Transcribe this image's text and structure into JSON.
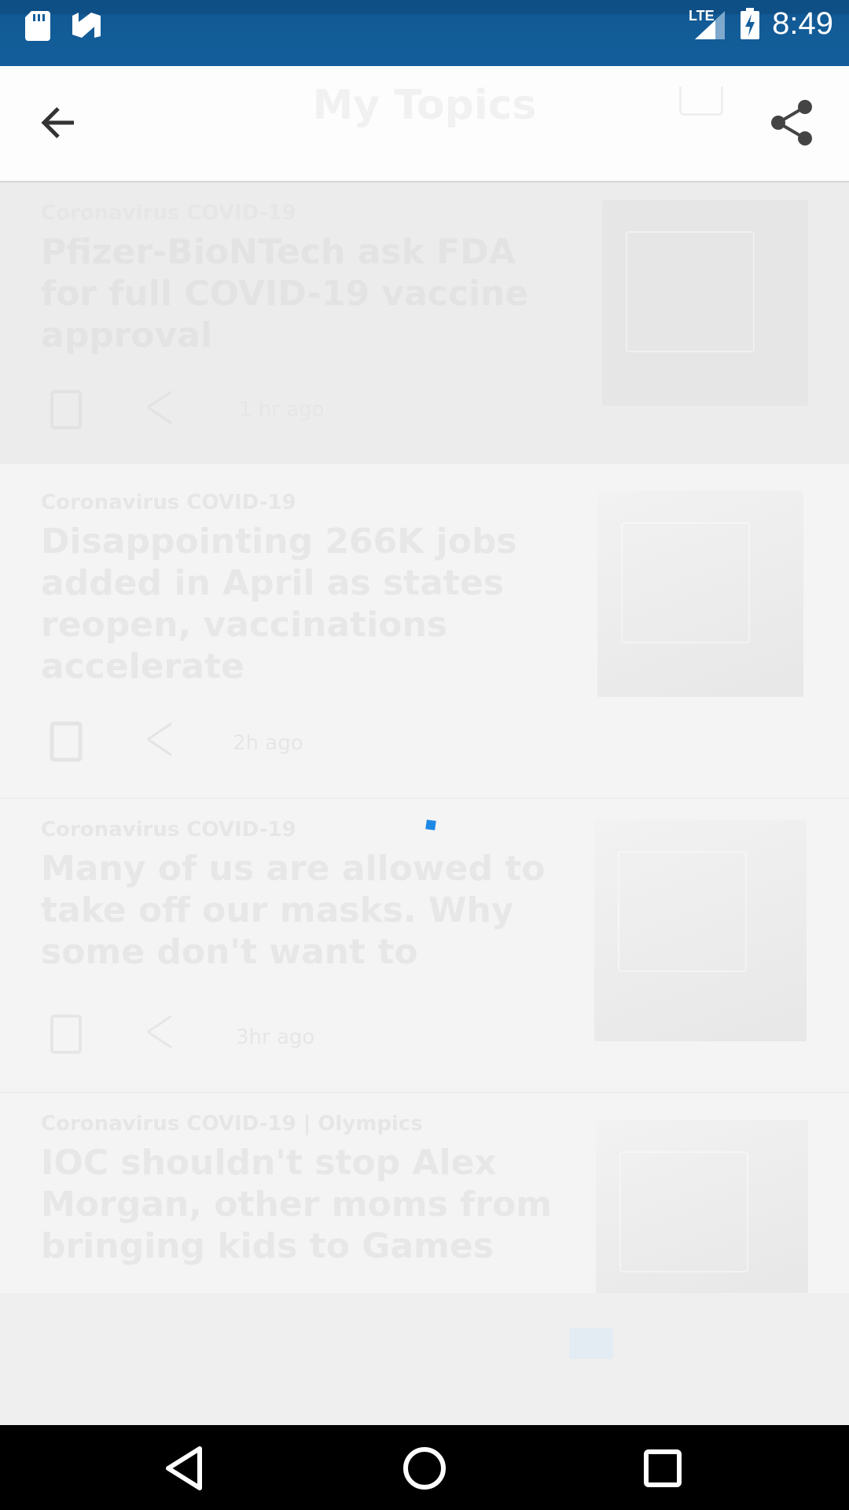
{
  "status_bar": {
    "time": "8:49",
    "network": "LTE",
    "icons": [
      "sd-card-icon",
      "n-notification-icon",
      "lte-signal-icon",
      "battery-charging-icon"
    ]
  },
  "app_bar": {
    "title": "My Topics",
    "back_icon": "arrow-back-icon",
    "share_icon": "share-icon"
  },
  "articles": [
    {
      "topic": "Coronavirus COVID-19",
      "headline": "Pfizer-BioNTech ask FDA for full COVID-19 vaccine approval",
      "time": "1 hr ago"
    },
    {
      "topic": "Coronavirus COVID-19",
      "headline": "Disappointing 266K jobs added in April as states reopen, vaccinations accelerate",
      "time": "2h ago"
    },
    {
      "topic": "Coronavirus COVID-19",
      "headline": "Many of us are allowed to take off our masks. Why some don't want to",
      "time": "3hr ago"
    },
    {
      "topic": "Coronavirus COVID-19 | Olympics",
      "headline": "IOC shouldn't stop Alex Morgan, other moms from bringing kids to Games",
      "time": ""
    }
  ],
  "loading_indicator_color": "#1e88e5",
  "nav_bar": {
    "buttons": [
      "back-triangle-icon",
      "home-circle-icon",
      "recents-square-icon"
    ]
  }
}
